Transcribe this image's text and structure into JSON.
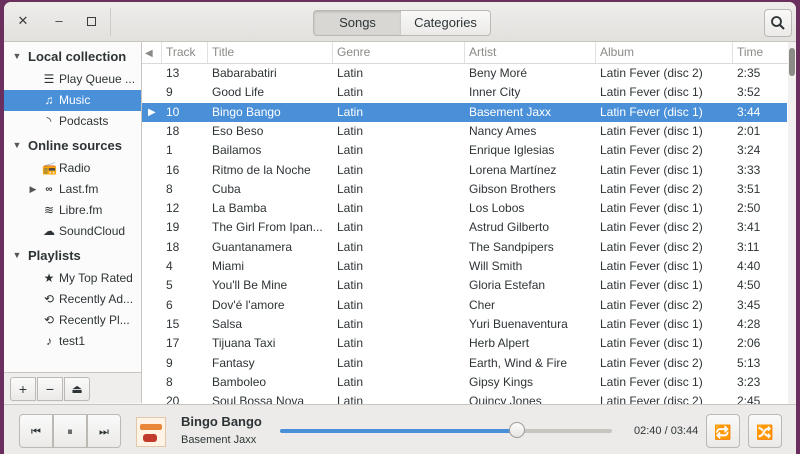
{
  "header": {
    "tabs": [
      {
        "label": "Songs"
      },
      {
        "label": "Categories"
      }
    ]
  },
  "sidebar": {
    "sections": [
      {
        "label": "Local collection",
        "items": [
          {
            "label": "Play Queue ...",
            "icon": "list-icon"
          },
          {
            "label": "Music",
            "icon": "music-note-icon",
            "selected": true
          },
          {
            "label": "Podcasts",
            "icon": "rss-icon"
          }
        ]
      },
      {
        "label": "Online sources",
        "items": [
          {
            "label": "Radio",
            "icon": "radio-icon"
          },
          {
            "label": "Last.fm",
            "icon": "lastfm-icon",
            "expandable": true
          },
          {
            "label": "Libre.fm",
            "icon": "wifi-icon"
          },
          {
            "label": "SoundCloud",
            "icon": "cloud-icon"
          }
        ]
      },
      {
        "label": "Playlists",
        "items": [
          {
            "label": "My Top Rated",
            "icon": "star-icon"
          },
          {
            "label": "Recently Ad...",
            "icon": "history-icon"
          },
          {
            "label": "Recently Pl...",
            "icon": "history-icon"
          },
          {
            "label": "test1",
            "icon": "playlist-icon"
          }
        ]
      }
    ],
    "toolbar": {
      "add": "+",
      "remove": "−",
      "eject": "⏏"
    }
  },
  "table": {
    "columns": [
      "Track",
      "Genre",
      "Artist",
      "Album",
      "Time"
    ],
    "title_column": "Title",
    "rows": [
      {
        "track": "13",
        "title": "Babarabatiri",
        "genre": "Latin",
        "artist": "Beny Moré",
        "album": "Latin Fever (disc 2)",
        "time": "2:35"
      },
      {
        "track": "9",
        "title": "Good Life",
        "genre": "Latin",
        "artist": "Inner City",
        "album": "Latin Fever (disc 1)",
        "time": "3:52"
      },
      {
        "track": "10",
        "title": "Bingo Bango",
        "genre": "Latin",
        "artist": "Basement Jaxx",
        "album": "Latin Fever (disc 1)",
        "time": "3:44",
        "selected": true,
        "playing": true
      },
      {
        "track": "18",
        "title": "Eso Beso",
        "genre": "Latin",
        "artist": "Nancy Ames",
        "album": "Latin Fever (disc 1)",
        "time": "2:01"
      },
      {
        "track": "1",
        "title": "Bailamos",
        "genre": "Latin",
        "artist": "Enrique Iglesias",
        "album": "Latin Fever (disc 2)",
        "time": "3:24"
      },
      {
        "track": "16",
        "title": "Ritmo de la Noche",
        "genre": "Latin",
        "artist": "Lorena Martínez",
        "album": "Latin Fever (disc 1)",
        "time": "3:33"
      },
      {
        "track": "8",
        "title": "Cuba",
        "genre": "Latin",
        "artist": "Gibson Brothers",
        "album": "Latin Fever (disc 2)",
        "time": "3:51"
      },
      {
        "track": "12",
        "title": "La Bamba",
        "genre": "Latin",
        "artist": "Los Lobos",
        "album": "Latin Fever (disc 1)",
        "time": "2:50"
      },
      {
        "track": "19",
        "title": "The Girl From Ipan...",
        "genre": "Latin",
        "artist": "Astrud Gilberto",
        "album": "Latin Fever (disc 2)",
        "time": "3:41"
      },
      {
        "track": "18",
        "title": "Guantanamera",
        "genre": "Latin",
        "artist": "The Sandpipers",
        "album": "Latin Fever (disc 2)",
        "time": "3:11"
      },
      {
        "track": "4",
        "title": "Miami",
        "genre": "Latin",
        "artist": "Will Smith",
        "album": "Latin Fever (disc 1)",
        "time": "4:40"
      },
      {
        "track": "5",
        "title": "You'll Be Mine",
        "genre": "Latin",
        "artist": "Gloria Estefan",
        "album": "Latin Fever (disc 1)",
        "time": "4:50"
      },
      {
        "track": "6",
        "title": "Dov'é l'amore",
        "genre": "Latin",
        "artist": "Cher",
        "album": "Latin Fever (disc 2)",
        "time": "3:45"
      },
      {
        "track": "15",
        "title": "Salsa",
        "genre": "Latin",
        "artist": "Yuri Buenaventura",
        "album": "Latin Fever (disc 1)",
        "time": "4:28"
      },
      {
        "track": "17",
        "title": "Tijuana Taxi",
        "genre": "Latin",
        "artist": "Herb Alpert",
        "album": "Latin Fever (disc 1)",
        "time": "2:06"
      },
      {
        "track": "9",
        "title": "Fantasy",
        "genre": "Latin",
        "artist": "Earth, Wind & Fire",
        "album": "Latin Fever (disc 2)",
        "time": "5:13"
      },
      {
        "track": "8",
        "title": "Bamboleo",
        "genre": "Latin",
        "artist": "Gipsy Kings",
        "album": "Latin Fever (disc 1)",
        "time": "3:23"
      },
      {
        "track": "20",
        "title": "Soul Bossa Nova",
        "genre": "Latin",
        "artist": "Quincy Jones",
        "album": "Latin Fever (disc 2)",
        "time": "2:45"
      }
    ]
  },
  "player": {
    "title": "Bingo Bango",
    "artist": "Basement Jaxx",
    "time": "02:40 / 03:44",
    "progress": 0.714,
    "accent": "#4a90d9"
  }
}
